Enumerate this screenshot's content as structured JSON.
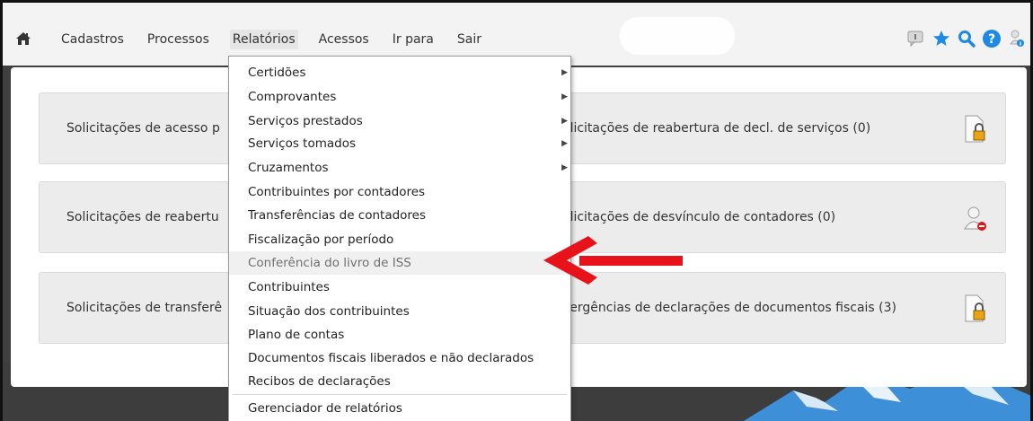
{
  "nav": {
    "items": [
      "Cadastros",
      "Processos",
      "Relatórios",
      "Acessos",
      "Ir para",
      "Sair"
    ],
    "active": "Relatórios",
    "icons": [
      "message-icon",
      "star-icon",
      "search-icon",
      "help-icon",
      "user-icon"
    ]
  },
  "cards": [
    {
      "label": "Solicitações de acesso p",
      "icon": "document-lock-icon"
    },
    {
      "label": "olicitações de reabertura de decl. de serviços (0)",
      "icon": "document-lock-icon"
    },
    {
      "label": "Solicitações de reabertu",
      "icon": "none"
    },
    {
      "label": "olicitações de desvínculo de contadores (0)",
      "icon": "user-remove-icon"
    },
    {
      "label": "Solicitações de transferê",
      "icon": "none"
    },
    {
      "label": "vergências de declarações de documentos fiscais (3)",
      "icon": "document-lock-icon"
    }
  ],
  "dropdown": {
    "items": [
      {
        "label": "Certidões",
        "submenu": true
      },
      {
        "label": "Comprovantes",
        "submenu": true
      },
      {
        "label": "Serviços prestados",
        "submenu": true
      },
      {
        "label": "Serviços tomados",
        "submenu": true
      },
      {
        "label": "Cruzamentos",
        "submenu": true
      },
      {
        "label": "Contribuintes por contadores",
        "submenu": false
      },
      {
        "label": "Transferências de contadores",
        "submenu": false
      },
      {
        "label": "Fiscalização por período",
        "submenu": false
      },
      {
        "label": "Conferência do livro de ISS",
        "submenu": false,
        "highlighted": true
      },
      {
        "label": "Contribuintes",
        "submenu": false
      },
      {
        "label": "Situação dos contribuintes",
        "submenu": false
      },
      {
        "label": "Plano de contas",
        "submenu": false
      },
      {
        "label": "Documentos fiscais liberados e não declarados",
        "submenu": false
      },
      {
        "label": "Recibos de declarações",
        "submenu": false
      },
      {
        "label": "Gerenciador de relatórios",
        "submenu": false
      }
    ]
  },
  "colors": {
    "annotation_arrow": "#e8131a",
    "accent_blue": "#1e88e5",
    "card_bg": "#ececec",
    "nav_bg": "#f3f3f3"
  }
}
